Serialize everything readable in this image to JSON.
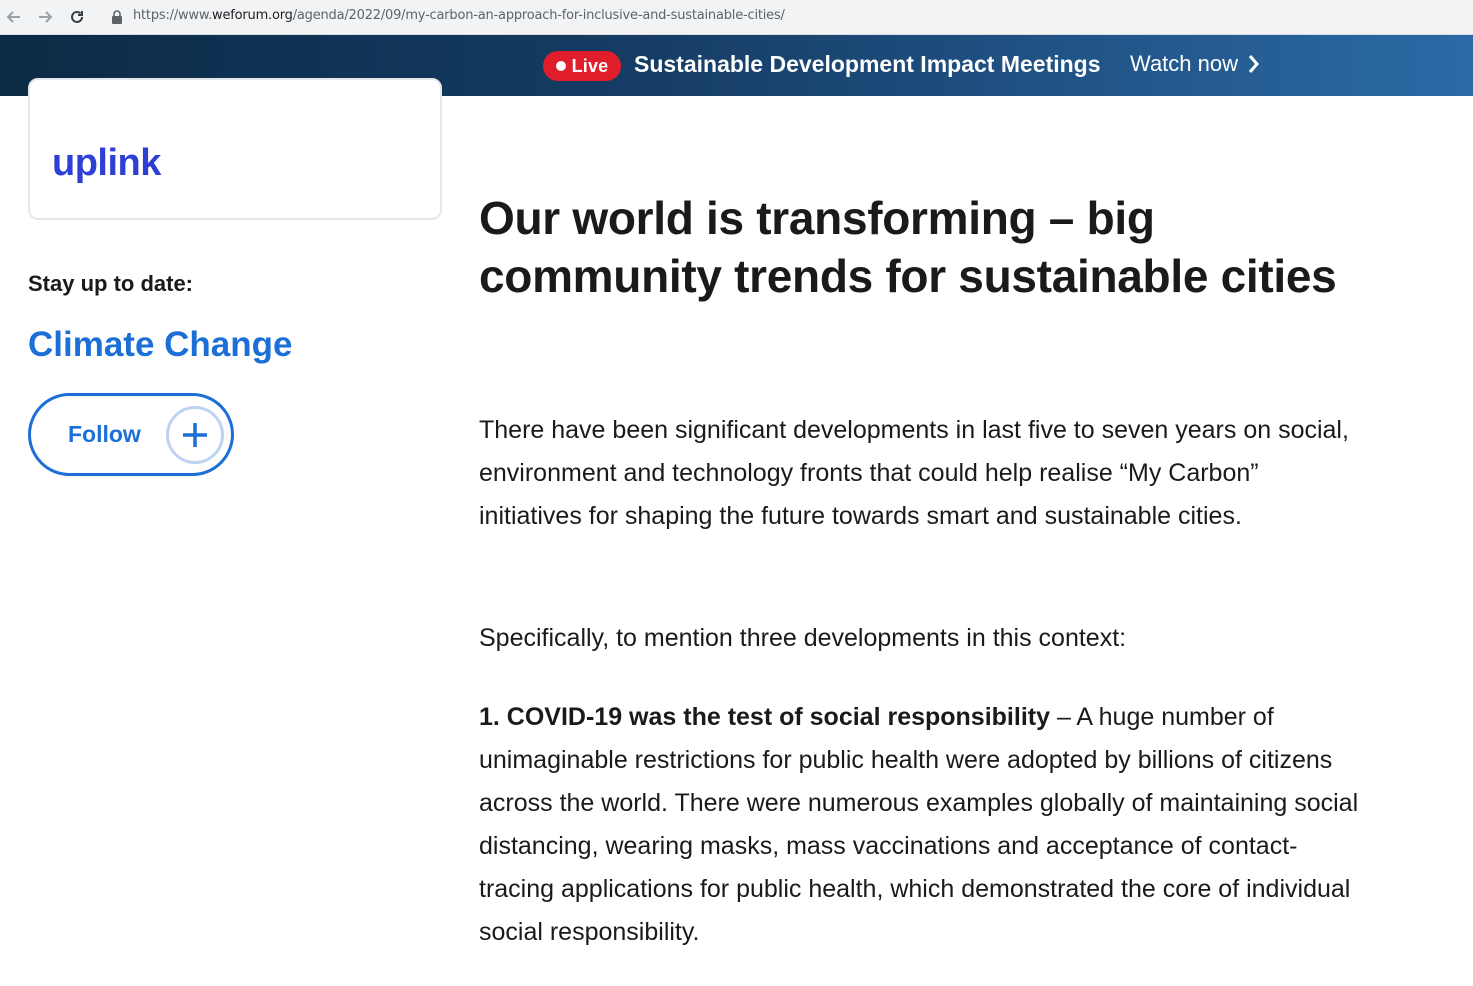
{
  "browser": {
    "url_prefix": "https://www.",
    "url_domain": "weforum.org",
    "url_path": "/agenda/2022/09/my-carbon-an-approach-for-inclusive-and-sustainable-cities/"
  },
  "banner": {
    "live_label": "Live",
    "title": "Sustainable Development Impact Meetings",
    "cta": "Watch now",
    "live_color": "#e01e2b"
  },
  "sidebar": {
    "logo_text": "uplink",
    "stay_label": "Stay up to date:",
    "topic": "Climate Change",
    "follow_label": "Follow",
    "accent_color": "#1b6fd6"
  },
  "article": {
    "title": "Our world is transforming – big community trends for sustainable cities",
    "paragraphs": [
      "There have been significant developments in last five to seven years on social, environment and technology fronts that could help realise “My Carbon” initiatives for shaping the future towards smart and sustainable cities.",
      "Specifically, to mention three developments in this context:"
    ],
    "point1_heading": "1. COVID-19 was the test of social responsibility",
    "point1_body": " – A huge number of unimaginable restrictions for public health were adopted by billions of citizens across the world. There were numerous examples globally of maintaining social distancing, wearing masks, mass vaccinations and acceptance of contact-tracing applications for public health, which demonstrated the core of individual social responsibility."
  }
}
